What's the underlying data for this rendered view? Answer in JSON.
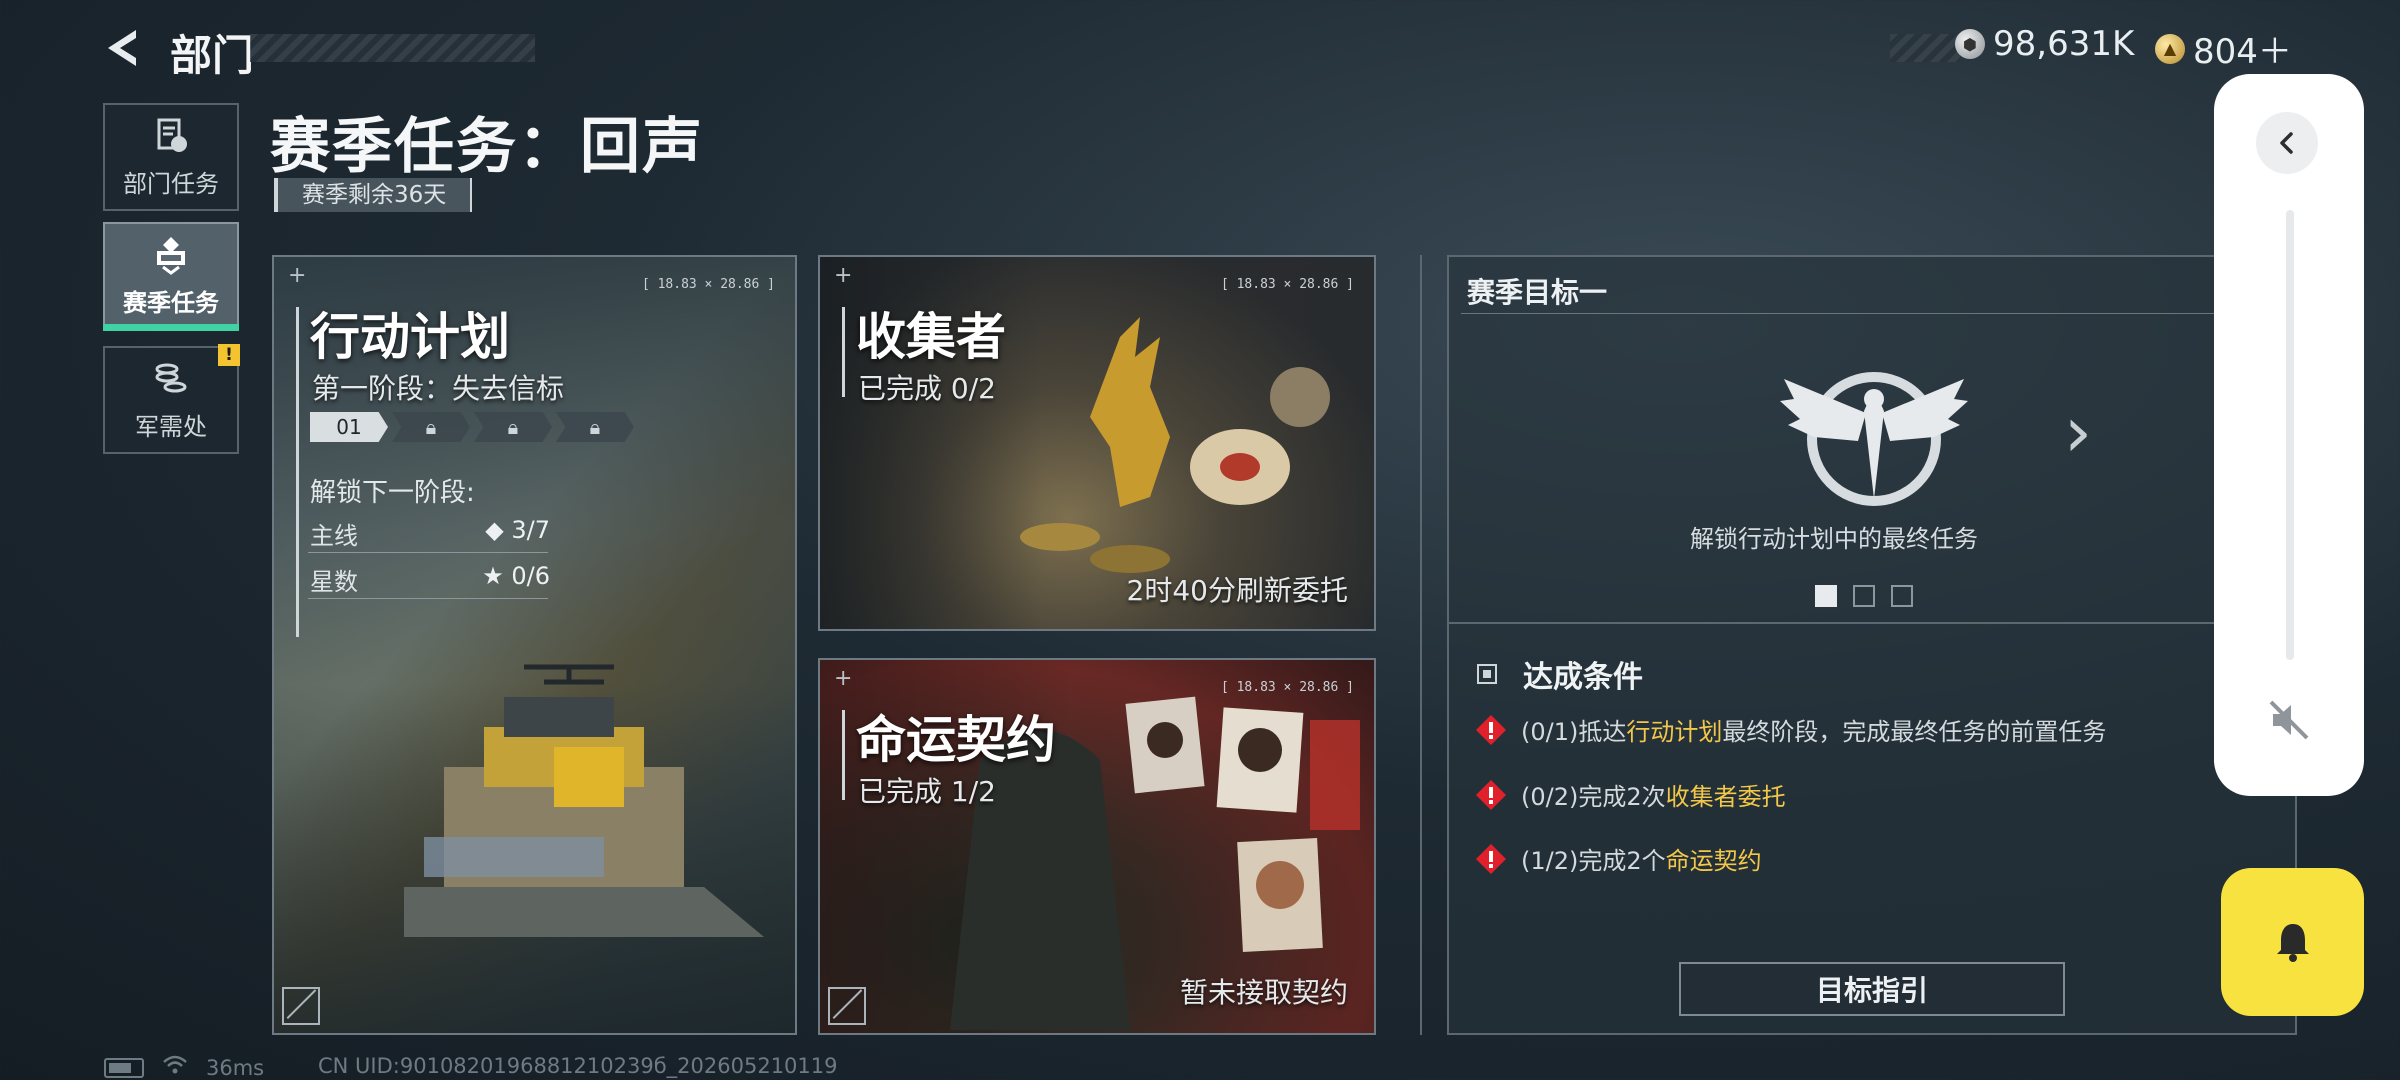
{
  "header": {
    "title": "部门",
    "currency": [
      {
        "icon": "silver-coin-icon",
        "value": "98,631K"
      },
      {
        "icon": "gold-coin-icon",
        "value": "804＋"
      }
    ]
  },
  "nav": {
    "items": [
      {
        "label": "部门任务",
        "icon": "document-icon"
      },
      {
        "label": "赛季任务",
        "icon": "season-emblem-icon"
      },
      {
        "label": "军需处",
        "icon": "coins-stack-icon",
        "badge": "!"
      }
    ]
  },
  "page": {
    "title": "赛季任务：回声",
    "season_left": "赛季剩余36天"
  },
  "cards": {
    "plan": {
      "title": "行动计划",
      "stage": "第一阶段：失去信标",
      "stages": [
        "01",
        "🔒",
        "🔒",
        "🔒"
      ],
      "unlock_label": "解锁下一阶段:",
      "main_label": "主线",
      "main_value": "◆ 3/7",
      "stars_label": "星数",
      "stars_value": "★ 0/6",
      "coord": "[ 18.83 × 28.86 ]"
    },
    "collector": {
      "title": "收集者",
      "progress": "已完成 0/2",
      "refresh": "2时40分刷新委托",
      "coord": "[ 18.83 × 28.86 ]"
    },
    "fate": {
      "title": "命运契约",
      "progress": "已完成 1/2",
      "status": "暂未接取契约",
      "coord": "[ 18.83 × 28.86 ]"
    }
  },
  "goal": {
    "heading": "赛季目标一",
    "desc": "解锁行动计划中的最终任务",
    "conditions_title": "达成条件",
    "conditions": [
      {
        "prefix": "(0/1)抵达",
        "highlight": "行动计划",
        "suffix": "最终阶段，完成最终任务的前置任务"
      },
      {
        "prefix": "(0/2)完成2次",
        "highlight": "收集者委托",
        "suffix": ""
      },
      {
        "prefix": "(1/2)完成2个",
        "highlight": "命运契约",
        "suffix": ""
      }
    ],
    "guide_button": "目标指引",
    "pager_total": 3,
    "pager_active": 1
  },
  "status": {
    "ping": "36ms",
    "uid": "CN UID:9010820196881210239б_202605210119"
  },
  "colors": {
    "accent_green": "#3fd3a4",
    "highlight_yellow": "#f3c74a",
    "warning_red": "#e0202a",
    "bell_yellow": "#f7e23f"
  }
}
